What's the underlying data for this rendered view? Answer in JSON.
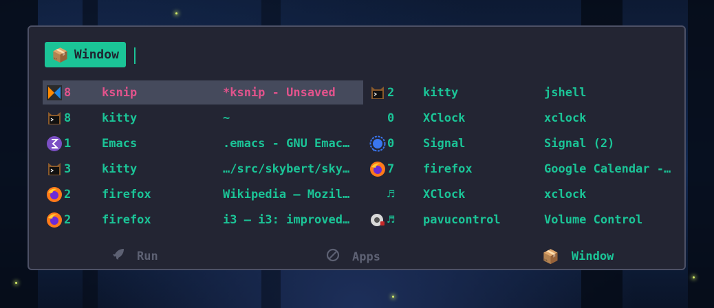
{
  "prompt": {
    "mode_icon": "package-icon",
    "mode_label": "Window"
  },
  "entries_left": [
    {
      "icon": "ksnip-icon",
      "num": "8",
      "cls": "ksnip",
      "title": "*ksnip - Unsaved",
      "selected": true
    },
    {
      "icon": "kitty-icon",
      "num": "8",
      "cls": "kitty",
      "title": "~"
    },
    {
      "icon": "emacs-icon",
      "num": "1",
      "cls": "Emacs",
      "title": ".emacs - GNU Emac…"
    },
    {
      "icon": "kitty-icon",
      "num": "3",
      "cls": "kitty",
      "title": "…/src/skybert/sky…"
    },
    {
      "icon": "firefox-icon",
      "num": "2",
      "cls": "firefox",
      "title": "Wikipedia — Mozil…"
    },
    {
      "icon": "firefox-icon",
      "num": "2",
      "cls": "firefox",
      "title": "i3 — i3: improved…"
    }
  ],
  "entries_right": [
    {
      "icon": "kitty-icon",
      "num": "2",
      "cls": "kitty",
      "title": "jshell"
    },
    {
      "icon": "none",
      "num": "0",
      "cls": "XClock",
      "title": "xclock"
    },
    {
      "icon": "signal-icon",
      "num": "0",
      "cls": "Signal",
      "title": "Signal (2)"
    },
    {
      "icon": "firefox-icon",
      "num": "7",
      "cls": "firefox",
      "title": "Google Calendar -…"
    },
    {
      "icon": "none",
      "num": "♬",
      "cls": "XClock",
      "title": "xclock"
    },
    {
      "icon": "pavucontrol-icon",
      "num": "♬",
      "cls": "pavucontrol",
      "title": "Volume Control"
    }
  ],
  "modes": [
    {
      "icon": "rocket-icon",
      "label": "Run",
      "active": false
    },
    {
      "icon": "block-icon",
      "label": "Apps",
      "active": false
    },
    {
      "icon": "package-icon",
      "label": "Window",
      "active": true
    }
  ],
  "colors": {
    "accent": "#1bc497",
    "selected_text": "#e2538c",
    "selected_bg": "#454a5c",
    "panel_bg": "#232533",
    "inactive": "#5d6173"
  }
}
